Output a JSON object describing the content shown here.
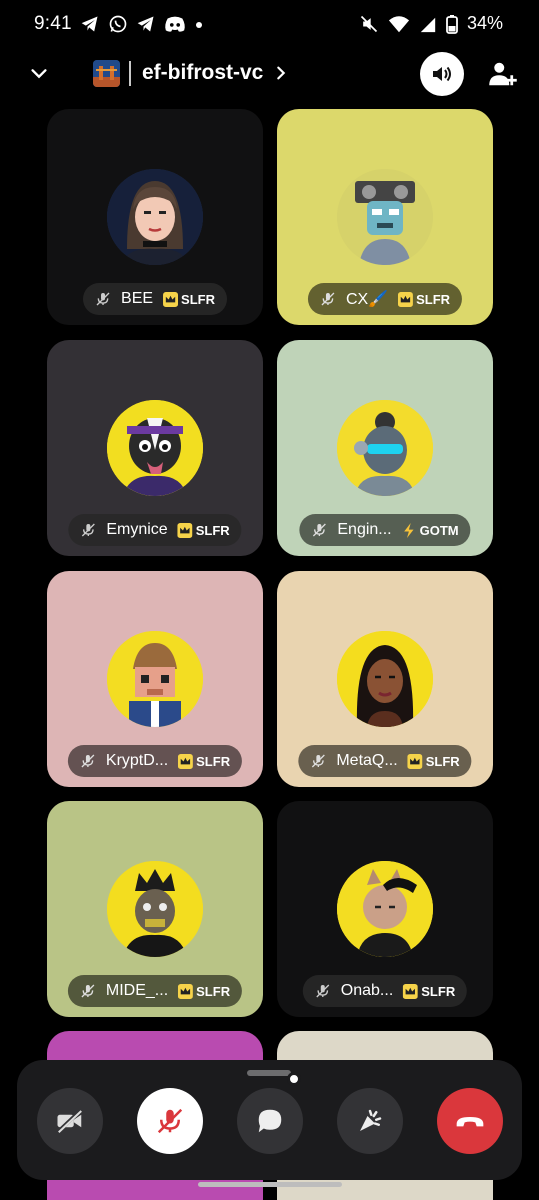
{
  "status_bar": {
    "time": "9:41",
    "battery_pct": "34%",
    "left_icons": [
      "telegram-icon",
      "whatsapp-icon",
      "telegram-icon",
      "discord-icon",
      "dot-icon"
    ],
    "right_icons": [
      "mute-icon",
      "wifi-icon",
      "signal-icon",
      "battery-icon"
    ]
  },
  "header": {
    "channel_name": "ef-bifrost-vc"
  },
  "participants": [
    {
      "name": "BEE",
      "tag": "SLFR",
      "tag_icon": "crown-badge-icon"
    },
    {
      "name": "CX🖌️",
      "tag": "SLFR",
      "tag_icon": "crown-badge-icon"
    },
    {
      "name": "Emynice",
      "tag": "SLFR",
      "tag_icon": "crown-badge-icon"
    },
    {
      "name": "Engin...",
      "tag": "GOTM",
      "tag_icon": "lightning-icon"
    },
    {
      "name": "KryptD...",
      "tag": "SLFR",
      "tag_icon": "crown-badge-icon"
    },
    {
      "name": "MetaQ...",
      "tag": "SLFR",
      "tag_icon": "crown-badge-icon"
    },
    {
      "name": "MIDE_...",
      "tag": "SLFR",
      "tag_icon": "crown-badge-icon"
    },
    {
      "name": "Onab...",
      "tag": "SLFR",
      "tag_icon": "crown-badge-icon"
    }
  ],
  "colors": {
    "background": "#000000",
    "end_call": "#da373c",
    "mic_muted": "#da373c"
  }
}
